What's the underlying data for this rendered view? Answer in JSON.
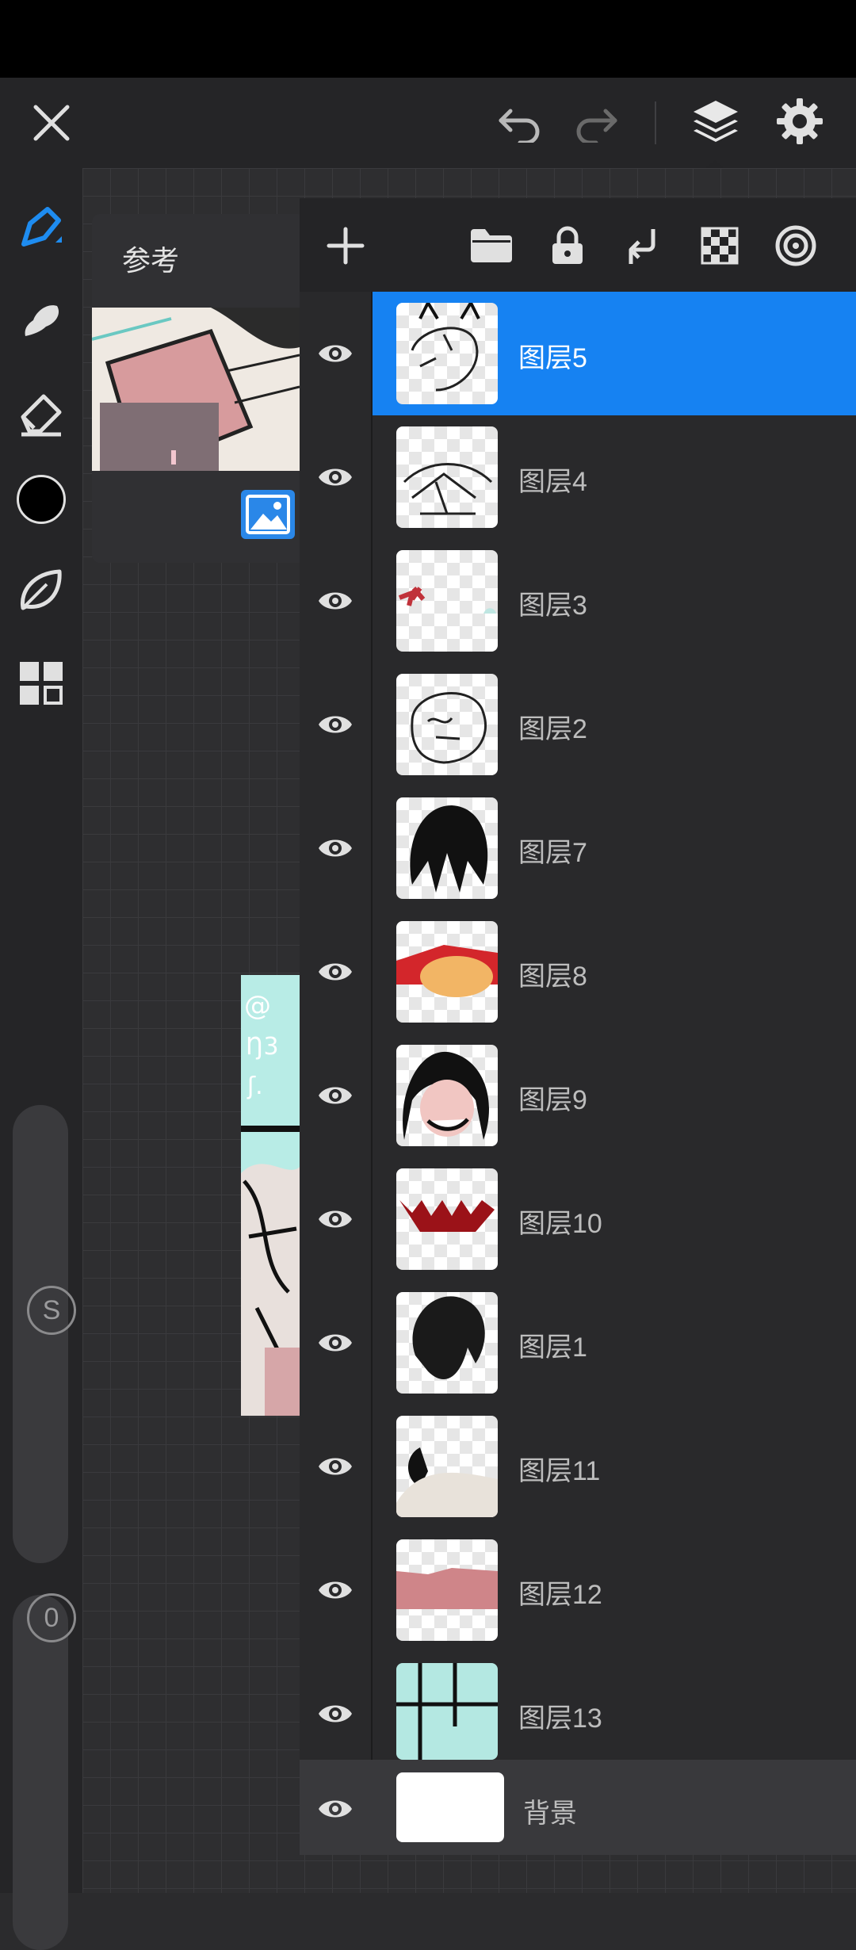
{
  "top_bar": {
    "close_icon": "close-icon",
    "undo_icon": "undo-icon",
    "redo_icon": "redo-icon",
    "layers_icon": "layers-icon",
    "settings_icon": "gear-icon"
  },
  "left_toolbar": {
    "tools": [
      "brush-icon",
      "smudge-icon",
      "eraser-icon",
      "color-swatch",
      "leaf-icon",
      "gallery-grid-icon"
    ],
    "size_slider_label": "S",
    "opacity_slider_label": "0",
    "color": "#000000"
  },
  "reference": {
    "title": "参考"
  },
  "layers_toolbar": [
    "add-layer-icon",
    "folder-icon",
    "lock-icon",
    "merge-down-icon",
    "alpha-lock-icon",
    "clipping-icon"
  ],
  "layers": [
    {
      "name": "图层5",
      "selected": true
    },
    {
      "name": "图层4",
      "selected": false
    },
    {
      "name": "图层3",
      "selected": false
    },
    {
      "name": "图层2",
      "selected": false
    },
    {
      "name": "图层7",
      "selected": false
    },
    {
      "name": "图层8",
      "selected": false
    },
    {
      "name": "图层9",
      "selected": false
    },
    {
      "name": "图层10",
      "selected": false
    },
    {
      "name": "图层1",
      "selected": false
    },
    {
      "name": "图层11",
      "selected": false
    },
    {
      "name": "图层12",
      "selected": false
    },
    {
      "name": "图层13",
      "selected": false
    }
  ],
  "background_layer": {
    "name": "背景"
  },
  "colors": {
    "accent": "#1682f2",
    "panel": "#222224",
    "toolbar": "#252527"
  }
}
